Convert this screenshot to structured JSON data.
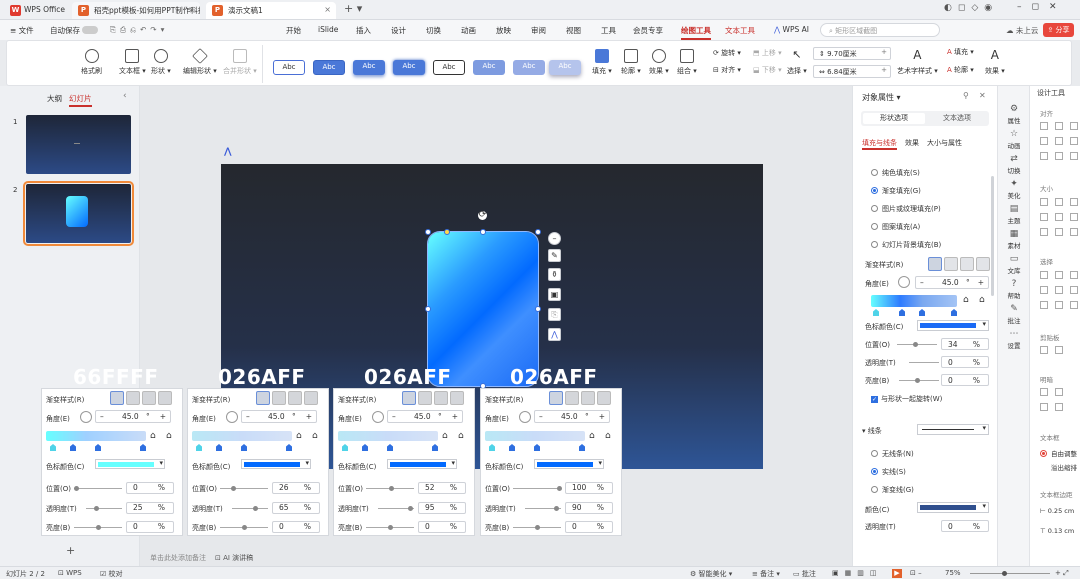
{
  "tabs": [
    {
      "label": "WPS Office",
      "icon": "wps-logo-icon"
    },
    {
      "label": "稻壳ppt模板-如何用PPT制作科技感",
      "icon": "ppt-file-icon"
    },
    {
      "label": "演示文稿1",
      "icon": "ppt-file-icon"
    }
  ],
  "menu": {
    "file": "文件",
    "autosave": "自动保存",
    "items": [
      "开始",
      "iSlide",
      "插入",
      "设计",
      "切换",
      "动画",
      "放映",
      "审阅",
      "视图",
      "工具",
      "会员专享",
      "绘图工具",
      "文本工具",
      "WPS AI"
    ],
    "search_placeholder": "矩形区域截图",
    "cloud": "未上云",
    "share": "分享"
  },
  "ribbon": {
    "format_painter": "格式刷",
    "textbox": "文本框",
    "shape": "形状",
    "edit_shape": "编辑形状",
    "merge_shape": "合并形状",
    "style_label": "Abc",
    "fill": "填充",
    "outline": "轮廓",
    "effect": "效果",
    "group": "组合",
    "rotate": "旋转",
    "align": "对齐",
    "up": "上移",
    "down": "下移",
    "select": "选择",
    "height": "9.70厘米",
    "width": "6.84厘米",
    "art": "艺术字样式",
    "text_fill": "填充",
    "text_outline": "轮廓",
    "text_effect": "效果"
  },
  "left_panel": {
    "outline": "大纲",
    "slides": "幻灯片",
    "slide_numbers": [
      "1",
      "2"
    ]
  },
  "gradient_panels": [
    {
      "code": "66FFFF",
      "style_label": "渐变样式(R)",
      "angle_label": "角度(E)",
      "angle": "45.0",
      "degree": "°",
      "color_label": "色标颜色(C)",
      "color": "#66ffff",
      "position_label": "位置(O)",
      "position": "0",
      "transparency_label": "透明度(T)",
      "transparency": "25",
      "brightness_label": "亮度(B)",
      "brightness": "0",
      "pct": "%"
    },
    {
      "code": "026AFF",
      "style_label": "渐变样式(R)",
      "angle_label": "角度(E)",
      "angle": "45.0",
      "degree": "°",
      "color_label": "色标颜色(C)",
      "color": "#026aff",
      "position_label": "位置(O)",
      "position": "26",
      "transparency_label": "透明度(T)",
      "transparency": "65",
      "brightness_label": "亮度(B)",
      "brightness": "0",
      "pct": "%"
    },
    {
      "code": "026AFF",
      "style_label": "渐变样式(R)",
      "angle_label": "角度(E)",
      "angle": "45.0",
      "degree": "°",
      "color_label": "色标颜色(C)",
      "color": "#026aff",
      "position_label": "位置(O)",
      "position": "52",
      "transparency_label": "透明度(T)",
      "transparency": "95",
      "brightness_label": "亮度(B)",
      "brightness": "0",
      "pct": "%"
    },
    {
      "code": "026AFF",
      "style_label": "渐变样式(R)",
      "angle_label": "角度(E)",
      "angle": "45.0",
      "degree": "°",
      "color_label": "色标颜色(C)",
      "color": "#026aff",
      "position_label": "位置(O)",
      "position": "100",
      "transparency_label": "透明度(T)",
      "transparency": "90",
      "brightness_label": "亮度(B)",
      "brightness": "0",
      "pct": "%"
    }
  ],
  "notes_placeholder": "单击此处添加备注",
  "ai_notes": "AI 演讲稿",
  "right_panel": {
    "title": "对象属性",
    "shape_tab": "形状选项",
    "text_tab": "文本选项",
    "sub_tabs": [
      "填充与线条",
      "效果",
      "大小与属性"
    ],
    "fill_options": [
      "纯色填充(S)",
      "渐变填充(G)",
      "图片或纹理填充(P)",
      "图案填充(A)",
      "幻灯片背景填充(B)"
    ],
    "style_label": "渐变样式(R)",
    "angle_label": "角度(E)",
    "angle": "45.0",
    "degree": "°",
    "color_label": "色标颜色(C)",
    "position_label": "位置(O)",
    "position": "34",
    "transparency_label": "透明度(T)",
    "transparency": "0",
    "brightness_label": "亮度(B)",
    "brightness": "0",
    "pct": "%",
    "rotate_with_shape": "与形状一起旋转(W)",
    "line_section": "线条",
    "line_options": [
      "无线条(N)",
      "实线(S)",
      "渐变线(G)"
    ],
    "color": "颜色(C)",
    "line_transparency_label": "透明度(T)",
    "line_transparency": "0"
  },
  "sidebar": [
    {
      "label": "属性",
      "icon": "properties-icon"
    },
    {
      "label": "动画",
      "icon": "animation-icon"
    },
    {
      "label": "切换",
      "icon": "transition-icon"
    },
    {
      "label": "美化",
      "icon": "beautify-icon"
    },
    {
      "label": "主题",
      "icon": "theme-icon"
    },
    {
      "label": "素材",
      "icon": "material-icon"
    },
    {
      "label": "文库",
      "icon": "library-icon"
    },
    {
      "label": "帮助",
      "icon": "help-icon"
    },
    {
      "label": "批注",
      "icon": "comment-icon"
    },
    {
      "label": "设置",
      "icon": "settings-icon"
    }
  ],
  "far_right": {
    "title": "设计工具",
    "align": "对齐",
    "size": "大小",
    "select": "选择",
    "clip": "剪贴板",
    "bright": "明暗",
    "textbox": "文本框",
    "auto_adjust": "自由调整",
    "overflow": "溢出缩排",
    "margin": "文本框边距",
    "margin1": "0.25 cm",
    "margin2": "0.13 cm"
  },
  "status": {
    "slide": "幻灯片 2 / 2",
    "wps": "WPS",
    "proof": "校对",
    "smart": "智能美化",
    "notes": "备注",
    "comment": "批注",
    "zoom": "75%"
  }
}
